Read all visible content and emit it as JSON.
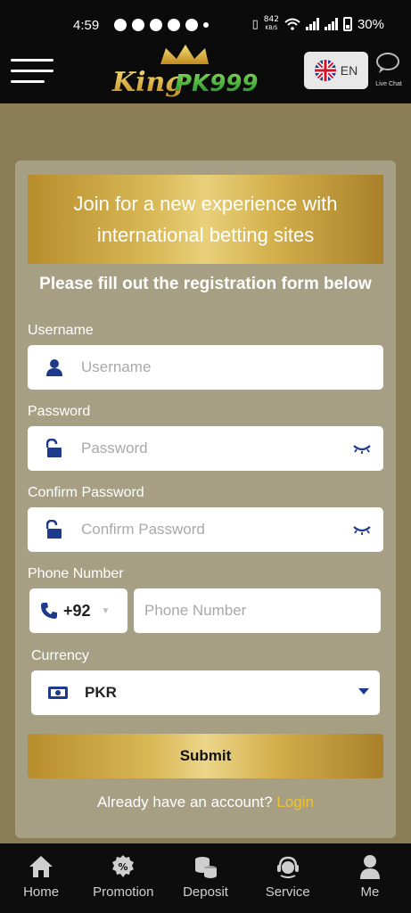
{
  "status_bar": {
    "time": "4:59",
    "net_speed": "842",
    "net_unit": "KB/S",
    "battery": "30%"
  },
  "header": {
    "logo_text": "KingPK999",
    "language": "EN",
    "live_chat": "Live Chat"
  },
  "form": {
    "banner": "Join for a new experience with international betting sites",
    "subtitle": "Please fill out the registration form below",
    "username_label": "Username",
    "username_placeholder": "Username",
    "password_label": "Password",
    "password_placeholder": "Password",
    "confirm_label": "Confirm Password",
    "confirm_placeholder": "Confirm Password",
    "phone_label": "Phone Number",
    "phone_code": "+92",
    "phone_placeholder": "Phone Number",
    "currency_label": "Currency",
    "currency_value": "PKR",
    "submit": "Submit",
    "login_prompt": "Already have an account?",
    "login_link": "Login"
  },
  "nav": {
    "items": [
      {
        "label": "Home",
        "icon": "home-icon"
      },
      {
        "label": "Promotion",
        "icon": "promotion-icon"
      },
      {
        "label": "Deposit",
        "icon": "deposit-icon"
      },
      {
        "label": "Service",
        "icon": "service-icon"
      },
      {
        "label": "Me",
        "icon": "user-icon"
      }
    ]
  },
  "colors": {
    "background": "#8b7d55",
    "card": "#a69f84",
    "gold": "#d9b856",
    "link": "#f2c230",
    "icon_blue": "#1e3a8a"
  }
}
